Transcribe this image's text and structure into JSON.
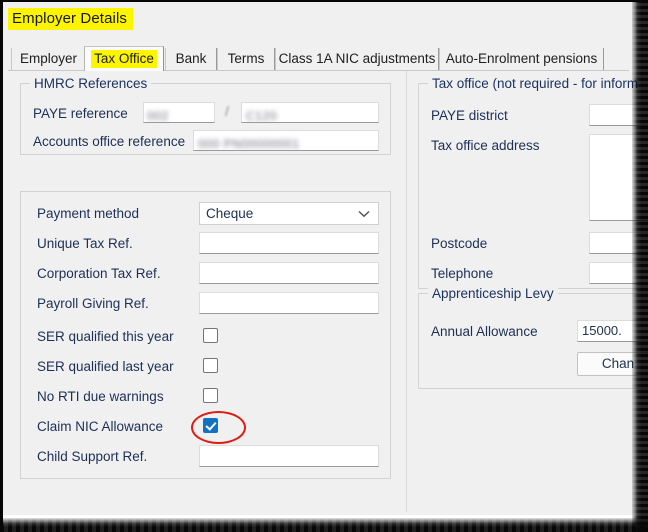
{
  "window": {
    "title": "Employer Details",
    "title_highlight_color": "#fcf400"
  },
  "tabs": [
    {
      "label": "Employer",
      "active": false
    },
    {
      "label": "Tax Office",
      "active": true
    },
    {
      "label": "Bank",
      "active": false
    },
    {
      "label": "Terms",
      "active": false
    },
    {
      "label": "Class 1A NIC adjustments",
      "active": false
    },
    {
      "label": "Auto-Enrolment pensions",
      "active": false
    }
  ],
  "hmrc_references": {
    "legend": "HMRC References",
    "paye_reference_label": "PAYE reference",
    "paye_reference_part1": "002",
    "paye_separator": "/",
    "paye_reference_part2": "C120",
    "accounts_office_reference_label": "Accounts office reference",
    "accounts_office_reference_value": "000 PN00000001"
  },
  "details": {
    "payment_method_label": "Payment method",
    "payment_method_value": "Cheque",
    "payment_method_options": [
      "Cheque"
    ],
    "unique_tax_ref_label": "Unique Tax Ref.",
    "unique_tax_ref_value": "",
    "corporation_tax_ref_label": "Corporation Tax Ref.",
    "corporation_tax_ref_value": "",
    "payroll_giving_ref_label": "Payroll Giving Ref.",
    "payroll_giving_ref_value": "",
    "ser_this_year_label": "SER qualified this year",
    "ser_this_year_checked": false,
    "ser_last_year_label": "SER qualified last year",
    "ser_last_year_checked": false,
    "no_rti_warnings_label": "No RTI due warnings",
    "no_rti_warnings_checked": false,
    "claim_nic_allowance_label": "Claim NIC Allowance",
    "claim_nic_allowance_checked": true,
    "child_support_ref_label": "Child Support Ref.",
    "child_support_ref_value": ""
  },
  "tax_office": {
    "legend": "Tax office (not required - for inform",
    "paye_district_label": "PAYE district",
    "paye_district_value": "",
    "tax_office_address_label": "Tax office address",
    "tax_office_address_value": "",
    "postcode_label": "Postcode",
    "postcode_value": "",
    "telephone_label": "Telephone",
    "telephone_value": ""
  },
  "apprenticeship_levy": {
    "legend": "Apprenticeship Levy",
    "annual_allowance_label": "Annual Allowance",
    "annual_allowance_value": "15000.",
    "change_button_label": "Chan"
  },
  "annotation": {
    "ellipse_color": "#e01b10",
    "target": "claim-nic-allowance-checkbox"
  }
}
